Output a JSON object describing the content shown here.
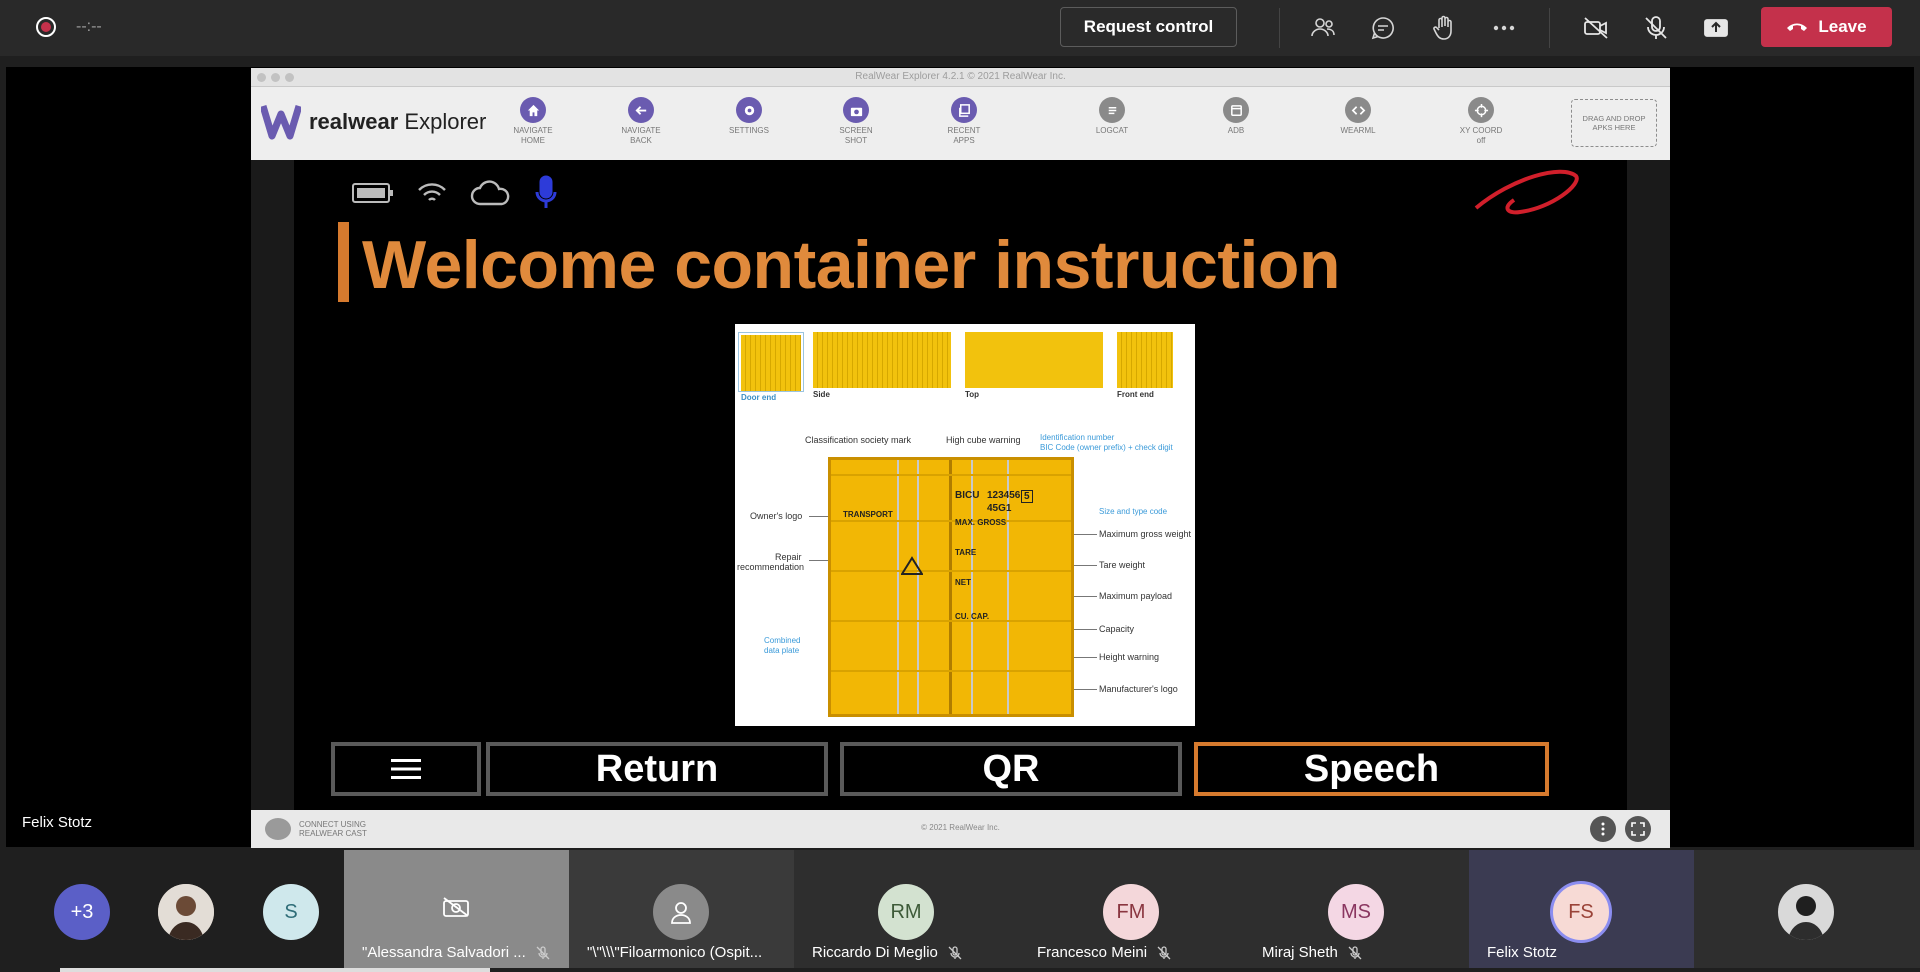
{
  "topbar": {
    "timer": "--:--",
    "request_control": "Request control",
    "leave": "Leave",
    "icons": [
      "participants-icon",
      "chat-icon",
      "raise-hand-icon",
      "more-icon",
      "camera-off-icon",
      "mic-off-icon",
      "share-icon"
    ]
  },
  "presenter": {
    "name": "Felix Stotz"
  },
  "realwear": {
    "title": "RealWear Explorer 4.2.1 © 2021 RealWear Inc.",
    "logo_bold": "realwear",
    "logo_light": "Explorer",
    "tools": [
      {
        "line1": "NAVIGATE",
        "line2": "HOME",
        "icon": "home-icon"
      },
      {
        "line1": "NAVIGATE",
        "line2": "BACK",
        "icon": "back-arrow-icon"
      },
      {
        "line1": "SETTINGS",
        "line2": "",
        "icon": "gear-icon"
      },
      {
        "line1": "SCREEN",
        "line2": "SHOT",
        "icon": "camera-icon"
      },
      {
        "line1": "RECENT",
        "line2": "APPS",
        "icon": "recent-apps-icon"
      },
      {
        "line1": "LOGCAT",
        "line2": "",
        "icon": "logcat-icon"
      },
      {
        "line1": "ADB",
        "line2": "",
        "icon": "adb-icon"
      },
      {
        "line1": "WEARML",
        "line2": "",
        "icon": "code-icon"
      },
      {
        "line1": "XY COORD",
        "line2": "off",
        "icon": "crosshair-icon"
      }
    ],
    "dropzone": "DRAG AND DROP APKS HERE",
    "footer": {
      "cast_line1": "CONNECT USING",
      "cast_line2": "REALWEAR CAST",
      "copyright": "© 2021 RealWear Inc."
    }
  },
  "device": {
    "heading": "Welcome container instruction",
    "buttons": [
      {
        "label": "Return"
      },
      {
        "label": "QR"
      },
      {
        "label": "Speech"
      }
    ],
    "diagram": {
      "thumbs": [
        "Door end",
        "Side",
        "Top",
        "Front end"
      ],
      "labels": {
        "classification": "Classification society mark",
        "high_cube": "High cube warning",
        "id_number": "Identification number",
        "bic_code": "BIC Code (owner prefix) + check digit",
        "owners_logo": "Owner's logo",
        "repair_1": "Repair",
        "repair_2": "recommendation",
        "combined_1": "Combined",
        "combined_2": "data plate",
        "size_type": "Size and type code",
        "max_gross": "Maximum gross weight",
        "tare": "Tare weight",
        "max_payload": "Maximum payload",
        "capacity": "Capacity",
        "height_warning": "Height warning",
        "manufacturer": "Manufacturer's logo"
      },
      "container_text": {
        "bicu": "BICU",
        "number": "123456",
        "check": "5",
        "code": "45G1",
        "transport": "TRANSPORT",
        "max_gross": "MAX. GROSS",
        "tare": "TARE",
        "net": "NET",
        "cu_cap": "CU. CAP."
      }
    }
  },
  "participants": [
    {
      "initials": "+3",
      "name": "",
      "color": "#5b5fc7"
    },
    {
      "initials": "",
      "name": "",
      "color": "#d8d8d8",
      "kind": "photo"
    },
    {
      "initials": "S",
      "name": "",
      "color": "#cfe8ec"
    },
    {
      "initials": "",
      "name": "\"Alessandra Salvadori ...",
      "color": "#8a8a8a",
      "kind": "camera-off"
    },
    {
      "initials": "",
      "name": "\"\\\"\\\\\\\"Filoarmonico (Ospit...",
      "color": "#8a8a8a",
      "kind": "person"
    },
    {
      "initials": "RM",
      "name": "Riccardo Di Meglio",
      "color": "#d3e2d0"
    },
    {
      "initials": "FM",
      "name": "Francesco Meini",
      "color": "#f4d7da"
    },
    {
      "initials": "MS",
      "name": "Miraj Sheth",
      "color": "#f4d7e4"
    },
    {
      "initials": "FS",
      "name": "Felix Stotz",
      "color": "#f7dad5"
    },
    {
      "initials": "",
      "name": "",
      "color": "#d8d8d8",
      "kind": "photo"
    }
  ]
}
